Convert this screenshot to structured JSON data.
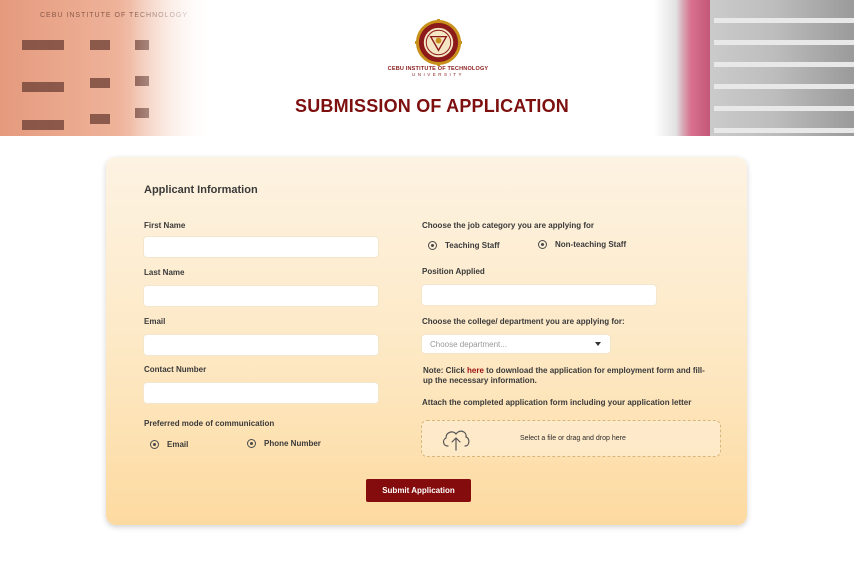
{
  "header": {
    "building_sign": "CEBU INSTITUTE OF TECHNOLOGY",
    "logo_name": "CEBU INSTITUTE OF TECHNOLOGY",
    "logo_sub": "UNIVERSITY",
    "page_title": "SUBMISSION OF APPLICATION"
  },
  "form": {
    "section_title": "Applicant Information",
    "first_name": {
      "label": "First Name",
      "value": "",
      "placeholder": ""
    },
    "last_name": {
      "label": "Last Name",
      "value": "",
      "placeholder": ""
    },
    "email": {
      "label": "Email",
      "value": "",
      "placeholder": ""
    },
    "contact_number": {
      "label": "Contact Number",
      "value": "",
      "placeholder": ""
    },
    "preferred_mode": {
      "label": "Preferred mode of communication",
      "options": [
        "Email",
        "Phone Number"
      ]
    },
    "job_category": {
      "label": "Choose the job category you are applying for",
      "options": [
        "Teaching Staff",
        "Non-teaching Staff"
      ]
    },
    "position_applied": {
      "label": "Position Applied",
      "value": "",
      "placeholder": ""
    },
    "department": {
      "label": "Choose the college/ department you are applying for:",
      "placeholder": "Choose department..."
    },
    "note": {
      "prefix": "Note: Click ",
      "link": "here",
      "suffix": " to download the application for employment form and fill-up the necessary information."
    },
    "attach_label": "Attach the completed application form including your application letter",
    "dropzone_text": "Select a file or drag and drop here",
    "submit_label": "Submit Application"
  },
  "colors": {
    "brand_maroon": "#850c0c",
    "title_maroon": "#7e0f0f",
    "card_top": "#fdf3e3",
    "card_bottom": "#fddaa0"
  },
  "icons": [
    "university-seal-icon",
    "upload-cloud-icon",
    "chevron-down-icon",
    "radio-icon"
  ]
}
